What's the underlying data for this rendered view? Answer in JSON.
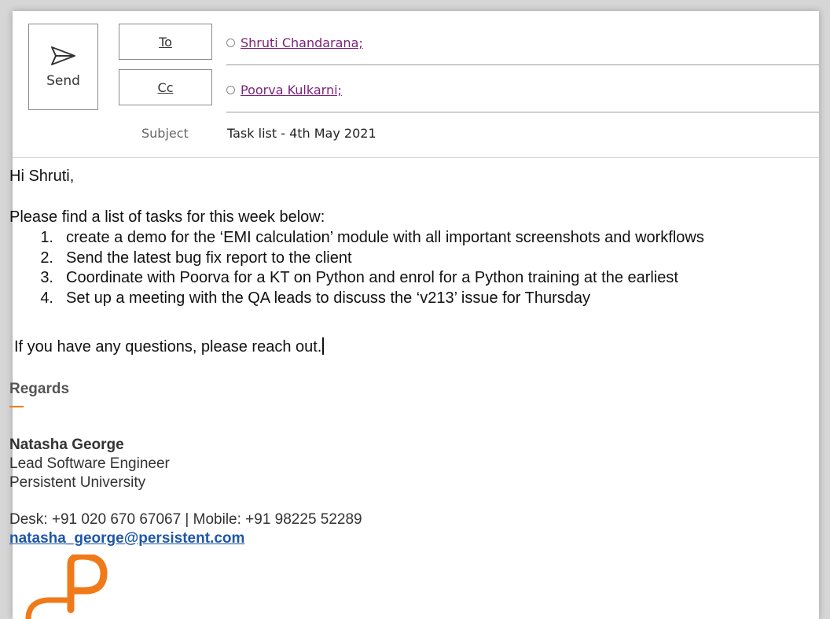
{
  "header": {
    "send_label": "Send",
    "to_label": "To",
    "cc_label": "Cc",
    "to_recipients": [
      "Shruti Chandarana;"
    ],
    "cc_recipients": [
      "Poorva Kulkarni;"
    ],
    "subject_label": "Subject",
    "subject_value": "Task list - 4th May 2021"
  },
  "body": {
    "greeting": "Hi Shruti,",
    "intro": "Please find a list of tasks for this week below:",
    "tasks": [
      {
        "num": "1.",
        "text": "create a demo for the ‘EMI calculation’ module with all important screenshots and workflows"
      },
      {
        "num": "2.",
        "text": "Send the latest bug fix report to the client"
      },
      {
        "num": "3.",
        "text": "Coordinate with Poorva for a KT on Python and enrol for a Python training at the earliest"
      },
      {
        "num": "4.",
        "text": "Set up a meeting with the QA leads to discuss the ‘v213’ issue for Thursday"
      }
    ],
    "closing": "If you have any questions, please reach out."
  },
  "signature": {
    "regards": "Regards",
    "name": "Natasha George",
    "title": "Lead Software Engineer",
    "org": "Persistent University",
    "phone": "Desk: +91 020 670 67067 | Mobile: +91 98225 52289",
    "email": "natasha_george@persistent.com"
  },
  "colors": {
    "recipient": "#7a1f7a",
    "email_link": "#1f57a6",
    "brand_orange": "#f07a1a"
  },
  "icons": {
    "send": "paper-plane-icon",
    "recipient_status": "presence-circle-icon",
    "logo": "persistent-logo"
  }
}
